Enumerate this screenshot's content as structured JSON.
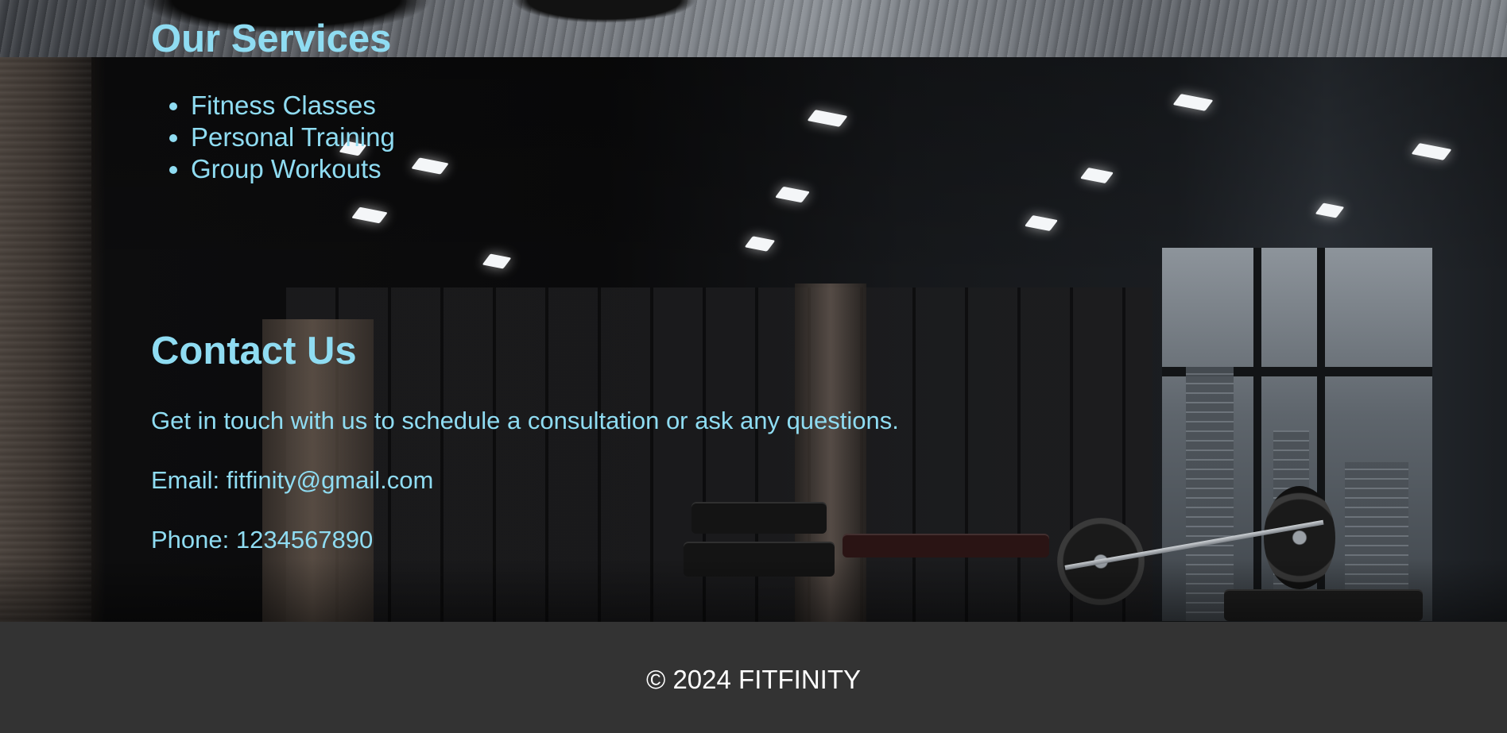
{
  "services": {
    "title": "Our Services",
    "items": [
      {
        "label": "Fitness Classes"
      },
      {
        "label": "Personal Training"
      },
      {
        "label": "Group Workouts"
      }
    ]
  },
  "contact": {
    "title": "Contact Us",
    "intro": "Get in touch with us to schedule a consultation or ask any questions.",
    "email": "Email: fitfinity@gmail.com",
    "phone": "Phone: 1234567890"
  },
  "footer": {
    "text": "© 2024 FITFINITY"
  },
  "colors": {
    "heading": "#8fdcf2",
    "footer_bg": "#333333",
    "footer_text": "#ffffff"
  }
}
